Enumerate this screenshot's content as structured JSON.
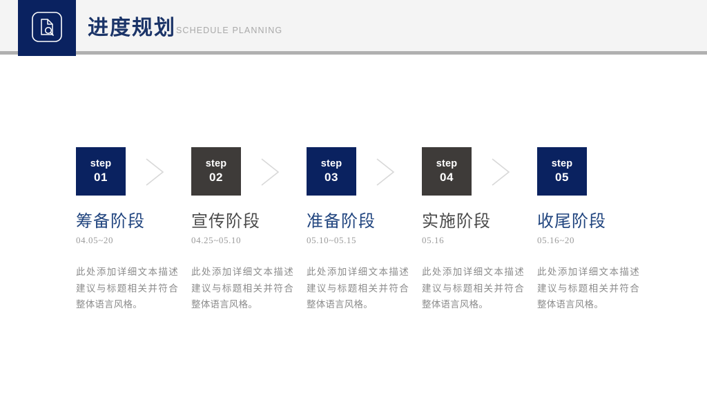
{
  "header": {
    "title": "进度规划",
    "subtitle": "SCHEDULE PLANNING",
    "badge_icon": "document-search-icon",
    "badge_color": "#0a2260",
    "background_color": "#f4f4f4",
    "rule_color": "#b0b0b0",
    "title_color": "#1b3468",
    "subtitle_color": "#a9a9a9"
  },
  "colors": {
    "navy": "#0a2260",
    "dark_gray": "#3e3b39",
    "title_navy": "#21457f",
    "title_gray": "#4b4b4b",
    "date_gray": "#9b9b9b",
    "body_gray": "#8c8c8c",
    "chevron_gray": "#d8d8d8"
  },
  "steps": [
    {
      "step_word": "step",
      "step_number": "01",
      "box_color": "#0a2260",
      "title": "筹备阶段",
      "title_color": "#21457f",
      "date": "04.05~20",
      "body": "此处添加详细文本描述建议与标题相关并符合整体语言风格。"
    },
    {
      "step_word": "step",
      "step_number": "02",
      "box_color": "#3e3b39",
      "title": "宣传阶段",
      "title_color": "#4b4b4b",
      "date": "04.25~05.10",
      "body": "此处添加详细文本描述建议与标题相关并符合整体语言风格。"
    },
    {
      "step_word": "step",
      "step_number": "03",
      "box_color": "#0a2260",
      "title": "准备阶段",
      "title_color": "#21457f",
      "date": "05.10~05.15",
      "body": "此处添加详细文本描述建议与标题相关并符合整体语言风格。"
    },
    {
      "step_word": "step",
      "step_number": "04",
      "box_color": "#3e3b39",
      "title": "实施阶段",
      "title_color": "#4b4b4b",
      "date": "05.16",
      "body": "此处添加详细文本描述建议与标题相关并符合整体语言风格。"
    },
    {
      "step_word": "step",
      "step_number": "05",
      "box_color": "#0a2260",
      "title": "收尾阶段",
      "title_color": "#21457f",
      "date": "05.16~20",
      "body": "此处添加详细文本描述建议与标题相关并符合整体语言风格。"
    }
  ],
  "connectors": [
    {
      "icon": "chevron-right-icon"
    },
    {
      "icon": "chevron-right-icon"
    },
    {
      "icon": "chevron-right-icon"
    },
    {
      "icon": "chevron-right-icon"
    }
  ]
}
